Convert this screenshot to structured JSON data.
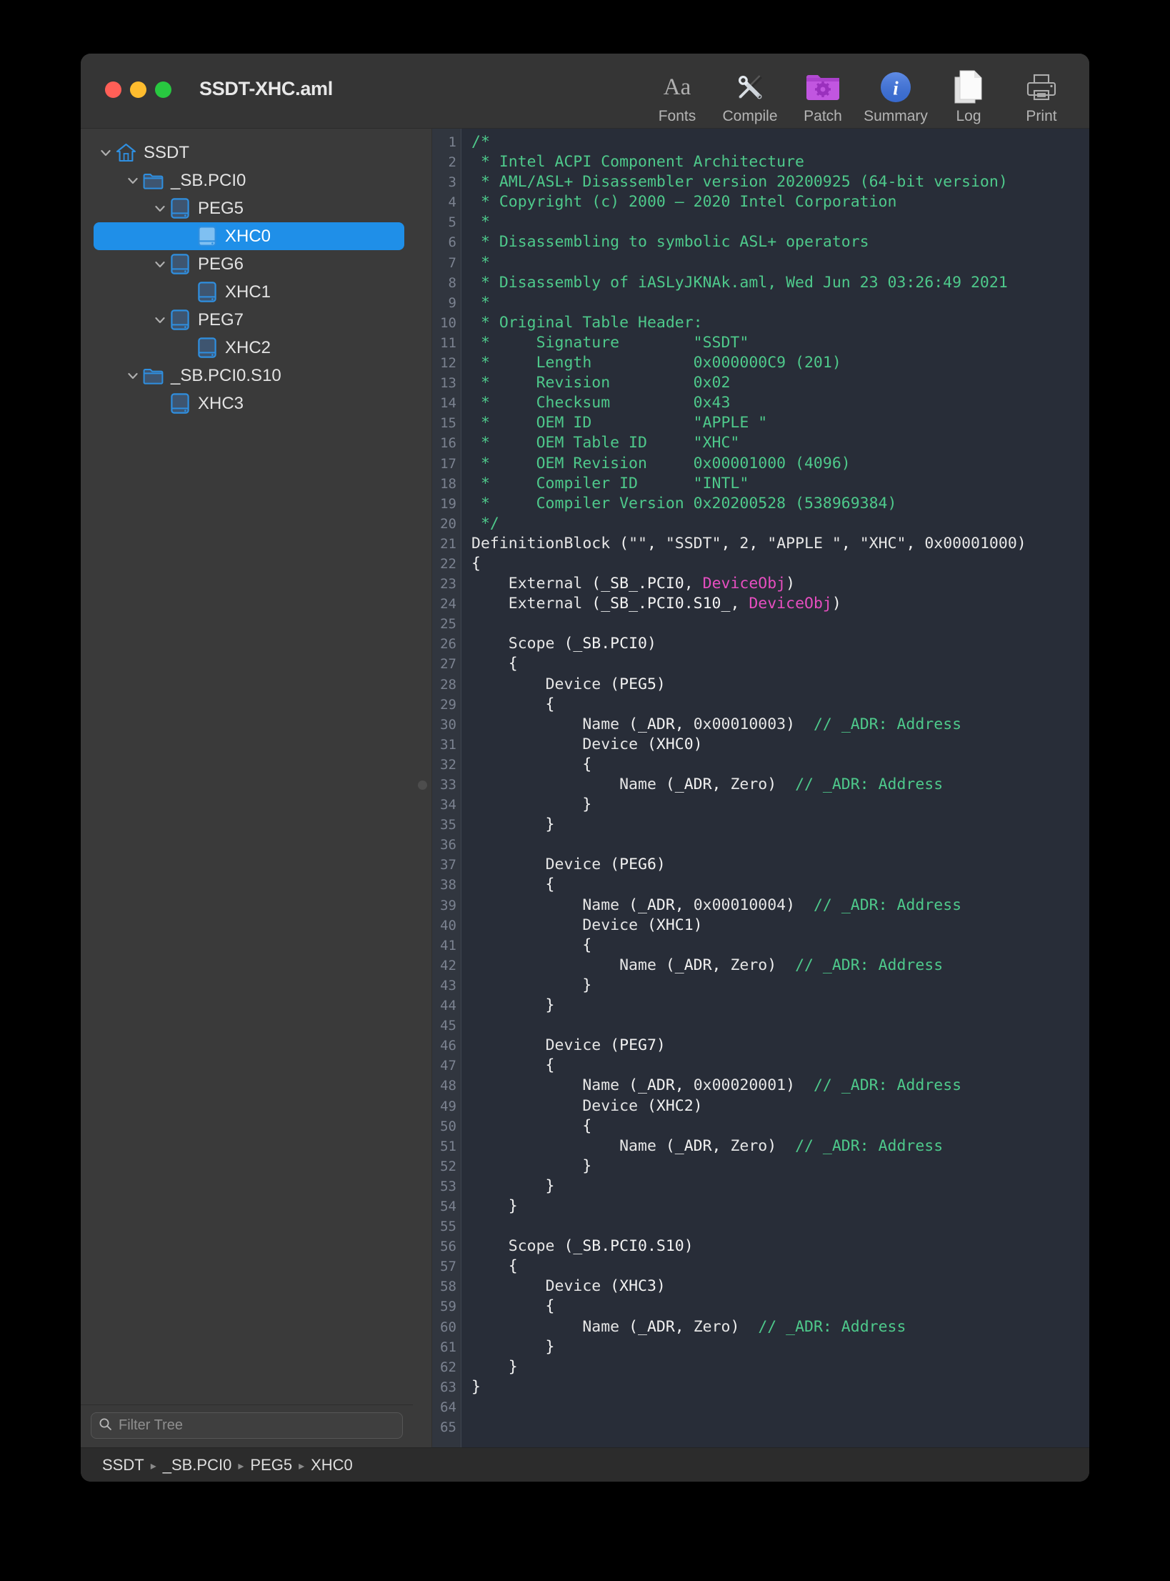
{
  "window": {
    "title": "SSDT-XHC.aml",
    "traffic_lights": [
      {
        "name": "close",
        "color": "#ff5f57"
      },
      {
        "name": "minimize",
        "color": "#febc2e"
      },
      {
        "name": "maximize",
        "color": "#28c840"
      }
    ]
  },
  "toolbar": {
    "items": [
      {
        "label": "Fonts",
        "icon": "fonts-aa-icon"
      },
      {
        "label": "Compile",
        "icon": "compile-tools-icon"
      },
      {
        "label": "Patch",
        "icon": "patch-folder-gear-icon"
      },
      {
        "label": "Summary",
        "icon": "summary-info-icon"
      },
      {
        "label": "Log",
        "icon": "log-document-icon"
      },
      {
        "label": "Print",
        "icon": "print-printer-icon"
      }
    ]
  },
  "sidebar": {
    "items": [
      {
        "label": "SSDT",
        "icon": "home-icon",
        "depth": 0,
        "disclosure": "open",
        "selected": false
      },
      {
        "label": "_SB.PCI0",
        "icon": "folder-icon",
        "depth": 1,
        "disclosure": "open",
        "selected": false
      },
      {
        "label": "PEG5",
        "icon": "device-icon",
        "depth": 2,
        "disclosure": "open",
        "selected": false
      },
      {
        "label": "XHC0",
        "icon": "device-icon",
        "depth": 3,
        "disclosure": "none",
        "selected": true
      },
      {
        "label": "PEG6",
        "icon": "device-icon",
        "depth": 2,
        "disclosure": "open",
        "selected": false
      },
      {
        "label": "XHC1",
        "icon": "device-icon",
        "depth": 3,
        "disclosure": "none",
        "selected": false
      },
      {
        "label": "PEG7",
        "icon": "device-icon",
        "depth": 2,
        "disclosure": "open",
        "selected": false
      },
      {
        "label": "XHC2",
        "icon": "device-icon",
        "depth": 3,
        "disclosure": "none",
        "selected": false
      },
      {
        "label": "_SB.PCI0.S10",
        "icon": "folder-icon",
        "depth": 1,
        "disclosure": "open",
        "selected": false
      },
      {
        "label": "XHC3",
        "icon": "device-icon",
        "depth": 2,
        "disclosure": "none",
        "selected": false
      }
    ],
    "filter": {
      "placeholder": "Filter Tree",
      "value": "",
      "icon": "search-icon"
    },
    "selection_color": "#1f8fe8"
  },
  "editor": {
    "first_line": 1,
    "last_line": 65,
    "total_lines": 65,
    "fold_marker_line": 33,
    "syntax_colors": {
      "comment": "#4ec98b",
      "keyword": "#29b8d8",
      "external": "#e8995a",
      "type": "#e64ec0",
      "string": "#ef4b5c",
      "number": "#9b95e0",
      "plain": "#f2f2f2",
      "background": "#282d38",
      "gutter_background": "#31363f",
      "gutter_text": "#7b8290"
    },
    "lines": [
      {
        "n": 1,
        "tokens": [
          {
            "t": "/*",
            "c": "comment"
          }
        ]
      },
      {
        "n": 2,
        "tokens": [
          {
            "t": " * Intel ACPI Component Architecture",
            "c": "comment"
          }
        ]
      },
      {
        "n": 3,
        "tokens": [
          {
            "t": " * AML/ASL+ Disassembler version 20200925 (64-bit version)",
            "c": "comment"
          }
        ]
      },
      {
        "n": 4,
        "tokens": [
          {
            "t": " * Copyright (c) 2000 – 2020 Intel Corporation",
            "c": "comment"
          }
        ]
      },
      {
        "n": 5,
        "tokens": [
          {
            "t": " *",
            "c": "comment"
          }
        ]
      },
      {
        "n": 6,
        "tokens": [
          {
            "t": " * Disassembling to symbolic ASL+ operators",
            "c": "comment"
          }
        ]
      },
      {
        "n": 7,
        "tokens": [
          {
            "t": " *",
            "c": "comment"
          }
        ]
      },
      {
        "n": 8,
        "tokens": [
          {
            "t": " * Disassembly of iASLyJKNAk.aml, Wed Jun 23 03:26:49 2021",
            "c": "comment"
          }
        ]
      },
      {
        "n": 9,
        "tokens": [
          {
            "t": " *",
            "c": "comment"
          }
        ]
      },
      {
        "n": 10,
        "tokens": [
          {
            "t": " * Original Table Header:",
            "c": "comment"
          }
        ]
      },
      {
        "n": 11,
        "tokens": [
          {
            "t": " *     Signature        \"SSDT\"",
            "c": "comment"
          }
        ]
      },
      {
        "n": 12,
        "tokens": [
          {
            "t": " *     Length           0x000000C9 (201)",
            "c": "comment"
          }
        ]
      },
      {
        "n": 13,
        "tokens": [
          {
            "t": " *     Revision         0x02",
            "c": "comment"
          }
        ]
      },
      {
        "n": 14,
        "tokens": [
          {
            "t": " *     Checksum         0x43",
            "c": "comment"
          }
        ]
      },
      {
        "n": 15,
        "tokens": [
          {
            "t": " *     OEM ID           \"APPLE \"",
            "c": "comment"
          }
        ]
      },
      {
        "n": 16,
        "tokens": [
          {
            "t": " *     OEM Table ID     \"XHC\"",
            "c": "comment"
          }
        ]
      },
      {
        "n": 17,
        "tokens": [
          {
            "t": " *     OEM Revision     0x00001000 (4096)",
            "c": "comment"
          }
        ]
      },
      {
        "n": 18,
        "tokens": [
          {
            "t": " *     Compiler ID      \"INTL\"",
            "c": "comment"
          }
        ]
      },
      {
        "n": 19,
        "tokens": [
          {
            "t": " *     Compiler Version 0x20200528 (538969384)",
            "c": "comment"
          }
        ]
      },
      {
        "n": 20,
        "tokens": [
          {
            "t": " */",
            "c": "comment"
          }
        ]
      },
      {
        "n": 21,
        "tokens": [
          {
            "t": "DefinitionBlock",
            "c": "keyword"
          },
          {
            "t": " (",
            "c": "plain"
          },
          {
            "t": "\"\"",
            "c": "string"
          },
          {
            "t": ", ",
            "c": "plain"
          },
          {
            "t": "\"SSDT\"",
            "c": "string"
          },
          {
            "t": ", ",
            "c": "plain"
          },
          {
            "t": "2",
            "c": "number"
          },
          {
            "t": ", ",
            "c": "plain"
          },
          {
            "t": "\"APPLE \"",
            "c": "string"
          },
          {
            "t": ", ",
            "c": "plain"
          },
          {
            "t": "\"XHC\"",
            "c": "string"
          },
          {
            "t": ", ",
            "c": "plain"
          },
          {
            "t": "0x00001000",
            "c": "number"
          },
          {
            "t": ")",
            "c": "plain"
          }
        ]
      },
      {
        "n": 22,
        "tokens": [
          {
            "t": "{",
            "c": "plain"
          }
        ]
      },
      {
        "n": 23,
        "tokens": [
          {
            "t": "    ",
            "c": "plain"
          },
          {
            "t": "External",
            "c": "external"
          },
          {
            "t": " (_SB_.PCI0, ",
            "c": "plain"
          },
          {
            "t": "DeviceObj",
            "c": "type"
          },
          {
            "t": ")",
            "c": "plain"
          }
        ]
      },
      {
        "n": 24,
        "tokens": [
          {
            "t": "    ",
            "c": "plain"
          },
          {
            "t": "External",
            "c": "external"
          },
          {
            "t": " (_SB_.PCI0.S10_, ",
            "c": "plain"
          },
          {
            "t": "DeviceObj",
            "c": "type"
          },
          {
            "t": ")",
            "c": "plain"
          }
        ]
      },
      {
        "n": 25,
        "tokens": []
      },
      {
        "n": 26,
        "tokens": [
          {
            "t": "    ",
            "c": "plain"
          },
          {
            "t": "Scope",
            "c": "keyword"
          },
          {
            "t": " (_SB.PCI0)",
            "c": "plain"
          }
        ]
      },
      {
        "n": 27,
        "tokens": [
          {
            "t": "    {",
            "c": "plain"
          }
        ]
      },
      {
        "n": 28,
        "tokens": [
          {
            "t": "        ",
            "c": "plain"
          },
          {
            "t": "Device",
            "c": "keyword"
          },
          {
            "t": " (PEG5)",
            "c": "plain"
          }
        ]
      },
      {
        "n": 29,
        "tokens": [
          {
            "t": "        {",
            "c": "plain"
          }
        ]
      },
      {
        "n": 30,
        "tokens": [
          {
            "t": "            ",
            "c": "plain"
          },
          {
            "t": "Name",
            "c": "keyword"
          },
          {
            "t": " (_ADR, ",
            "c": "plain"
          },
          {
            "t": "0x00010003",
            "c": "number"
          },
          {
            "t": ")  ",
            "c": "plain"
          },
          {
            "t": "// _ADR: Address",
            "c": "comment"
          }
        ]
      },
      {
        "n": 31,
        "tokens": [
          {
            "t": "            ",
            "c": "plain"
          },
          {
            "t": "Device",
            "c": "keyword"
          },
          {
            "t": " (XHC0)",
            "c": "plain"
          }
        ]
      },
      {
        "n": 32,
        "tokens": [
          {
            "t": "            {",
            "c": "plain"
          }
        ]
      },
      {
        "n": 33,
        "tokens": [
          {
            "t": "                ",
            "c": "plain"
          },
          {
            "t": "Name",
            "c": "keyword"
          },
          {
            "t": " (_ADR, ",
            "c": "plain"
          },
          {
            "t": "Zero",
            "c": "number"
          },
          {
            "t": ")  ",
            "c": "plain"
          },
          {
            "t": "// _ADR: Address",
            "c": "comment"
          }
        ]
      },
      {
        "n": 34,
        "tokens": [
          {
            "t": "            }",
            "c": "plain"
          }
        ]
      },
      {
        "n": 35,
        "tokens": [
          {
            "t": "        }",
            "c": "plain"
          }
        ]
      },
      {
        "n": 36,
        "tokens": []
      },
      {
        "n": 37,
        "tokens": [
          {
            "t": "        ",
            "c": "plain"
          },
          {
            "t": "Device",
            "c": "keyword"
          },
          {
            "t": " (PEG6)",
            "c": "plain"
          }
        ]
      },
      {
        "n": 38,
        "tokens": [
          {
            "t": "        {",
            "c": "plain"
          }
        ]
      },
      {
        "n": 39,
        "tokens": [
          {
            "t": "            ",
            "c": "plain"
          },
          {
            "t": "Name",
            "c": "keyword"
          },
          {
            "t": " (_ADR, ",
            "c": "plain"
          },
          {
            "t": "0x00010004",
            "c": "number"
          },
          {
            "t": ")  ",
            "c": "plain"
          },
          {
            "t": "// _ADR: Address",
            "c": "comment"
          }
        ]
      },
      {
        "n": 40,
        "tokens": [
          {
            "t": "            ",
            "c": "plain"
          },
          {
            "t": "Device",
            "c": "keyword"
          },
          {
            "t": " (XHC1)",
            "c": "plain"
          }
        ]
      },
      {
        "n": 41,
        "tokens": [
          {
            "t": "            {",
            "c": "plain"
          }
        ]
      },
      {
        "n": 42,
        "tokens": [
          {
            "t": "                ",
            "c": "plain"
          },
          {
            "t": "Name",
            "c": "keyword"
          },
          {
            "t": " (_ADR, ",
            "c": "plain"
          },
          {
            "t": "Zero",
            "c": "number"
          },
          {
            "t": ")  ",
            "c": "plain"
          },
          {
            "t": "// _ADR: Address",
            "c": "comment"
          }
        ]
      },
      {
        "n": 43,
        "tokens": [
          {
            "t": "            }",
            "c": "plain"
          }
        ]
      },
      {
        "n": 44,
        "tokens": [
          {
            "t": "        }",
            "c": "plain"
          }
        ]
      },
      {
        "n": 45,
        "tokens": []
      },
      {
        "n": 46,
        "tokens": [
          {
            "t": "        ",
            "c": "plain"
          },
          {
            "t": "Device",
            "c": "keyword"
          },
          {
            "t": " (PEG7)",
            "c": "plain"
          }
        ]
      },
      {
        "n": 47,
        "tokens": [
          {
            "t": "        {",
            "c": "plain"
          }
        ]
      },
      {
        "n": 48,
        "tokens": [
          {
            "t": "            ",
            "c": "plain"
          },
          {
            "t": "Name",
            "c": "keyword"
          },
          {
            "t": " (_ADR, ",
            "c": "plain"
          },
          {
            "t": "0x00020001",
            "c": "number"
          },
          {
            "t": ")  ",
            "c": "plain"
          },
          {
            "t": "// _ADR: Address",
            "c": "comment"
          }
        ]
      },
      {
        "n": 49,
        "tokens": [
          {
            "t": "            ",
            "c": "plain"
          },
          {
            "t": "Device",
            "c": "keyword"
          },
          {
            "t": " (XHC2)",
            "c": "plain"
          }
        ]
      },
      {
        "n": 50,
        "tokens": [
          {
            "t": "            {",
            "c": "plain"
          }
        ]
      },
      {
        "n": 51,
        "tokens": [
          {
            "t": "                ",
            "c": "plain"
          },
          {
            "t": "Name",
            "c": "keyword"
          },
          {
            "t": " (_ADR, ",
            "c": "plain"
          },
          {
            "t": "Zero",
            "c": "number"
          },
          {
            "t": ")  ",
            "c": "plain"
          },
          {
            "t": "// _ADR: Address",
            "c": "comment"
          }
        ]
      },
      {
        "n": 52,
        "tokens": [
          {
            "t": "            }",
            "c": "plain"
          }
        ]
      },
      {
        "n": 53,
        "tokens": [
          {
            "t": "        }",
            "c": "plain"
          }
        ]
      },
      {
        "n": 54,
        "tokens": [
          {
            "t": "    }",
            "c": "plain"
          }
        ]
      },
      {
        "n": 55,
        "tokens": []
      },
      {
        "n": 56,
        "tokens": [
          {
            "t": "    ",
            "c": "plain"
          },
          {
            "t": "Scope",
            "c": "keyword"
          },
          {
            "t": " (_SB.PCI0.S10)",
            "c": "plain"
          }
        ]
      },
      {
        "n": 57,
        "tokens": [
          {
            "t": "    {",
            "c": "plain"
          }
        ]
      },
      {
        "n": 58,
        "tokens": [
          {
            "t": "        ",
            "c": "plain"
          },
          {
            "t": "Device",
            "c": "keyword"
          },
          {
            "t": " (XHC3)",
            "c": "plain"
          }
        ]
      },
      {
        "n": 59,
        "tokens": [
          {
            "t": "        {",
            "c": "plain"
          }
        ]
      },
      {
        "n": 60,
        "tokens": [
          {
            "t": "            ",
            "c": "plain"
          },
          {
            "t": "Name",
            "c": "keyword"
          },
          {
            "t": " (_ADR, ",
            "c": "plain"
          },
          {
            "t": "Zero",
            "c": "number"
          },
          {
            "t": ")  ",
            "c": "plain"
          },
          {
            "t": "// _ADR: Address",
            "c": "comment"
          }
        ]
      },
      {
        "n": 61,
        "tokens": [
          {
            "t": "        }",
            "c": "plain"
          }
        ]
      },
      {
        "n": 62,
        "tokens": [
          {
            "t": "    }",
            "c": "plain"
          }
        ]
      },
      {
        "n": 63,
        "tokens": [
          {
            "t": "}",
            "c": "plain"
          }
        ]
      },
      {
        "n": 64,
        "tokens": []
      },
      {
        "n": 65,
        "tokens": []
      }
    ]
  },
  "statusbar": {
    "breadcrumb": [
      "SSDT",
      "_SB.PCI0",
      "PEG5",
      "XHC0"
    ],
    "separator": "▸"
  }
}
